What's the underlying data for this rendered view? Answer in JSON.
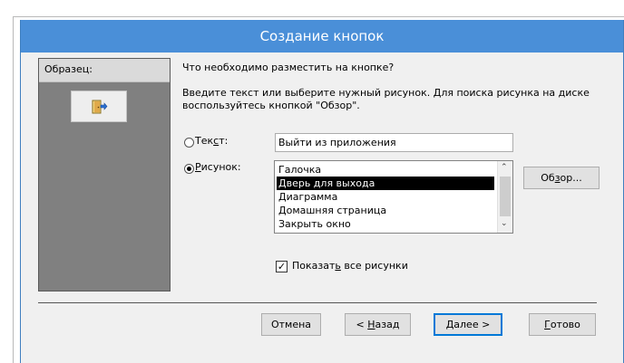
{
  "window": {
    "title": "Создание кнопок"
  },
  "sample": {
    "label": "Образец:",
    "icon": "exit-door-icon"
  },
  "prompt": {
    "question": "Что необходимо разместить на кнопке?",
    "instruction_line1": "Введите текст или выберите нужный рисунок.  Для поиска рисунка на диске",
    "instruction_line2": "воспользуйтесь кнопкой \"Обзор\"."
  },
  "text_option": {
    "label_pre": "Тек",
    "label_u": "с",
    "label_post": "т:",
    "value": "Выйти из приложения",
    "checked": false
  },
  "picture_option": {
    "label_pre": "",
    "label_u": "Р",
    "label_post": "исунок:",
    "checked": true,
    "items": [
      "Галочка",
      "Дверь для выхода",
      "Диаграмма",
      "Домашняя страница",
      "Закрыть окно"
    ],
    "selected_index": 1
  },
  "browse_button": {
    "label_pre": "Об",
    "label_u": "з",
    "label_post": "ор..."
  },
  "show_all": {
    "checked": true,
    "label_pre": "Показат",
    "label_u": "ь",
    "label_post": " все рисунки"
  },
  "buttons": {
    "cancel": "Отмена",
    "back_pre": "< ",
    "back_u": "Н",
    "back_post": "азад",
    "next_pre": "",
    "next_u": "Д",
    "next_post": "алее >",
    "finish_pre": "",
    "finish_u": "Г",
    "finish_post": "отово"
  },
  "colors": {
    "titlebar": "#4a8fd8",
    "selection": "#000000",
    "sample_panel": "#808080"
  }
}
